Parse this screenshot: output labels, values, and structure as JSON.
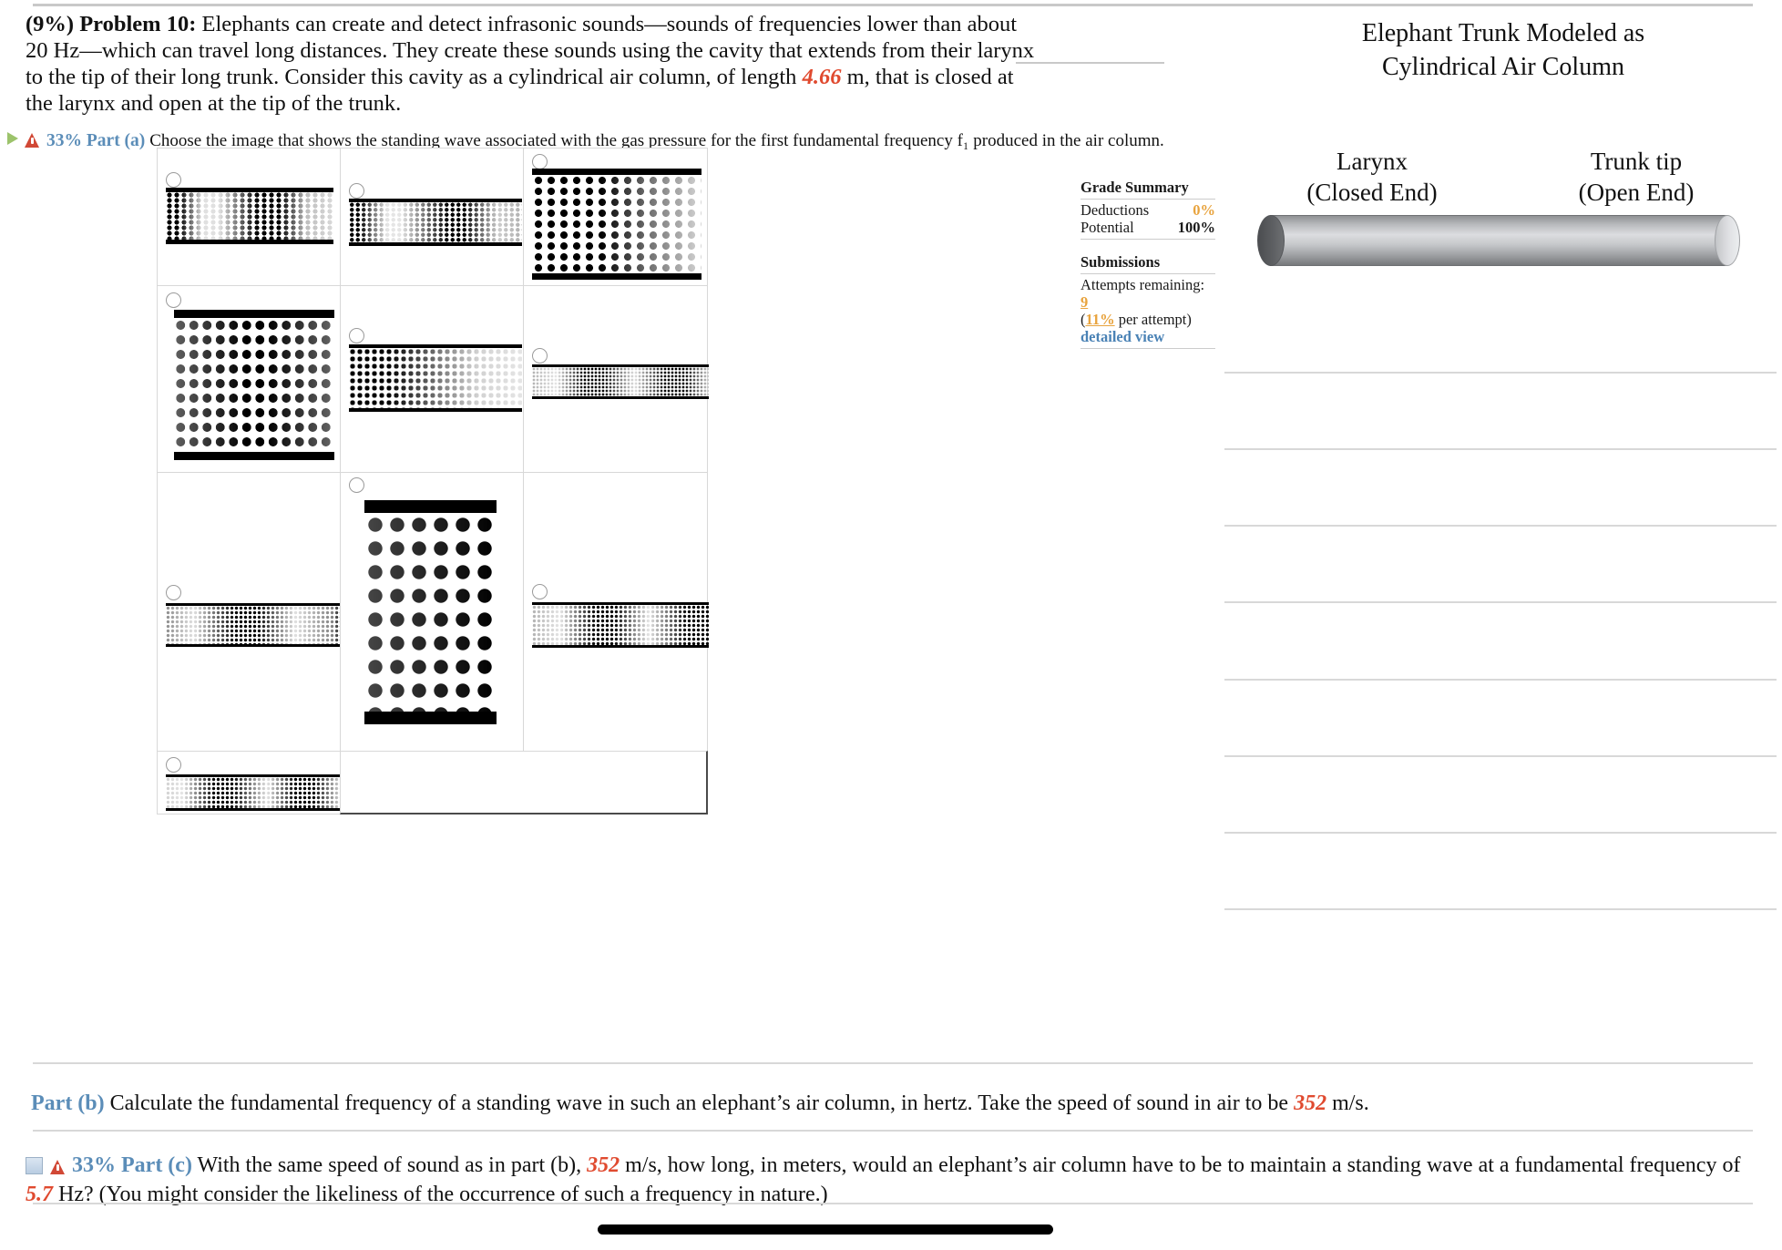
{
  "problem": {
    "weight": "(9%)",
    "label": "Problem 10:",
    "text_1": "Elephants can create and detect infrasonic sounds—sounds of frequencies lower than about 20 Hz—which can travel long distances. They create these sounds using the cavity that extends from their larynx to the tip of their long trunk. Consider this cavity as a cylindrical air column, of length ",
    "length_value": "4.66",
    "text_2": " m, that is closed at the larynx and open at the tip of the trunk."
  },
  "part_a": {
    "expand_icon": "triangle-right-icon",
    "warning_icon": "warning-triangle-icon",
    "percent": "33%",
    "label": "Part (a)",
    "question": "Choose the image that shows the standing wave associated with the gas pressure for the first fundamental frequency f₁ produced in the air column."
  },
  "answers": {
    "options": [
      {
        "id": "option-1",
        "pattern": "tube-horizontal",
        "nodes": "pressure-antinode-center-narrow"
      },
      {
        "id": "option-2",
        "pattern": "tube-horizontal",
        "nodes": "pressure-antinode-center-wide"
      },
      {
        "id": "option-3",
        "pattern": "tube-vertical",
        "nodes": "density-gradient-left-heavy"
      },
      {
        "id": "option-4",
        "pattern": "tube-vertical",
        "nodes": "density-uniform-center-peak"
      },
      {
        "id": "option-5",
        "pattern": "tube-horizontal",
        "nodes": "density-decreasing-right"
      },
      {
        "id": "option-6",
        "pattern": "tube-horizontal-thin",
        "nodes": "two-antinodes"
      },
      {
        "id": "option-7",
        "pattern": "tube-horizontal-thin",
        "nodes": "one-antinode-center"
      },
      {
        "id": "option-8",
        "pattern": "tube-vertical-tall",
        "nodes": "density-increasing-right"
      },
      {
        "id": "option-9",
        "pattern": "tube-horizontal-thin",
        "nodes": "antinode-left-and-right"
      },
      {
        "id": "option-10",
        "pattern": "tube-horizontal-thin",
        "nodes": "two-antinodes-spread"
      }
    ]
  },
  "grade_summary": {
    "title": "Grade Summary",
    "deductions_label": "Deductions",
    "deductions_value": "0%",
    "potential_label": "Potential",
    "potential_value": "100%",
    "submissions_title": "Submissions",
    "attempts_label": "Attempts remaining:",
    "attempts_value": "9",
    "per_attempt_open": "(",
    "per_attempt_pct": "11%",
    "per_attempt_rest": " per attempt)",
    "detailed_view": "detailed view"
  },
  "figure": {
    "title_line_1": "Elephant Trunk Modeled as",
    "title_line_2": "Cylindrical Air Column",
    "left_label_1": "Larynx",
    "left_label_2": "(Closed End)",
    "right_label_1": "Trunk tip",
    "right_label_2": "(Open End)",
    "cylinder_icon": "cylinder-shape"
  },
  "part_b": {
    "label": "Part (b)",
    "text_1": "Calculate the fundamental frequency of a standing wave in such an elephant’s air column, in hertz. Take the speed of sound in air to be ",
    "speed_value": "352",
    "text_2": " m/s."
  },
  "part_c": {
    "checkbox_icon": "checkbox-icon",
    "warning_icon": "warning-triangle-icon",
    "percent": "33%",
    "label": "Part (c)",
    "text_1": "With the same speed of sound as in part (b), ",
    "speed_value": "352",
    "text_2": " m/s, how long, in meters, would an elephant’s air column have to be to maintain a standing wave at a fundamental frequency of ",
    "freq_value": "5.7",
    "text_3": " Hz? (You might consider the likeliness of the occurrence of such a frequency in nature.)"
  },
  "colors": {
    "accent_blue": "#5b8db8",
    "value_red": "#e04a2f",
    "orange": "#e8a33d",
    "link_blue": "#4a82b5",
    "warning_red": "#d14836",
    "rule_gray": "#d8d8d8"
  },
  "scrollbar": {
    "icon": "horizontal-scrollbar-thumb"
  }
}
